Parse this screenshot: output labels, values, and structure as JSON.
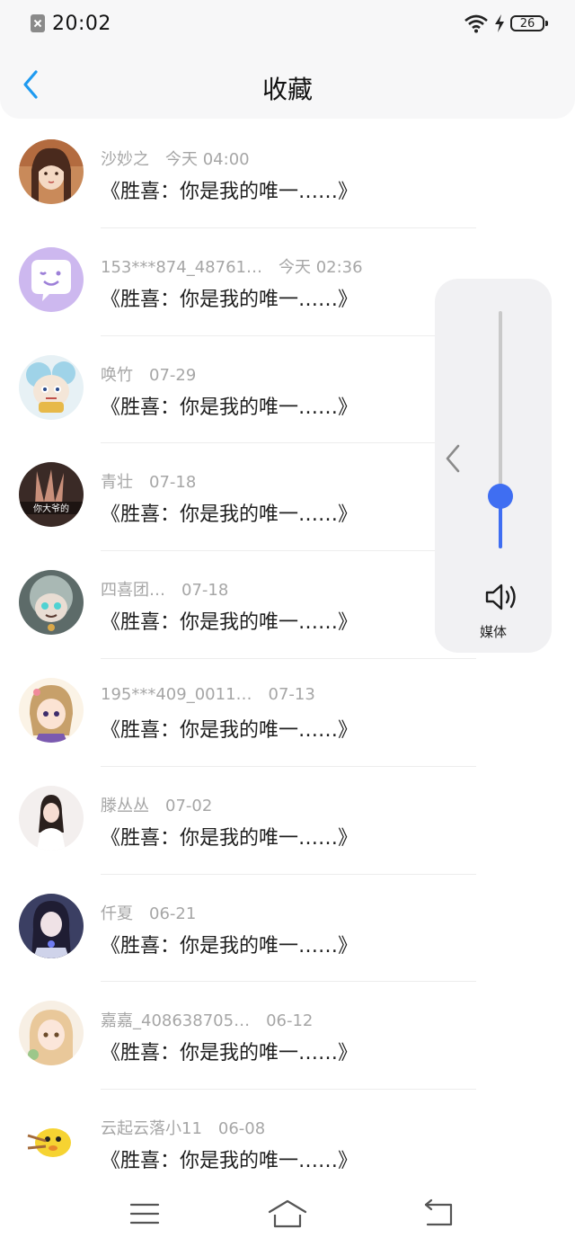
{
  "status_bar": {
    "time": "20:02",
    "battery": "26"
  },
  "header": {
    "title": "收藏"
  },
  "favorites": [
    {
      "name": "沙妙之",
      "time": "今天 04:00",
      "text": "《胜喜：你是我的唯一……》"
    },
    {
      "name": "153***874_48761…",
      "time": "今天 02:36",
      "text": "《胜喜：你是我的唯一……》"
    },
    {
      "name": "唤竹",
      "time": "07-29",
      "text": "《胜喜：你是我的唯一……》"
    },
    {
      "name": "青壮",
      "time": "07-18",
      "text": "《胜喜：你是我的唯一……》"
    },
    {
      "name": "四喜团…",
      "time": "07-18",
      "text": "《胜喜：你是我的唯一……》"
    },
    {
      "name": "195***409_0011…",
      "time": "07-13",
      "text": "《胜喜：你是我的唯一……》"
    },
    {
      "name": "滕丛丛",
      "time": "07-02",
      "text": "《胜喜：你是我的唯一……》"
    },
    {
      "name": "仟夏",
      "time": "06-21",
      "text": "《胜喜：你是我的唯一……》"
    },
    {
      "name": "嘉嘉_408638705…",
      "time": "06-12",
      "text": "《胜喜：你是我的唯一……》"
    },
    {
      "name": "云起云落小11",
      "time": "06-08",
      "text": "《胜喜：你是我的唯一……》"
    }
  ],
  "avatar_art": {
    "avatar_4_caption": "你大爷的"
  },
  "volume": {
    "label": "媒体",
    "level": 0.22,
    "accent": "#3f6ef2"
  },
  "icons": {
    "back": "chevron-left-icon",
    "volume_expand": "chevron-left-icon",
    "speaker": "speaker-icon",
    "menu": "menu-icon",
    "home": "home-icon",
    "return": "return-icon"
  }
}
